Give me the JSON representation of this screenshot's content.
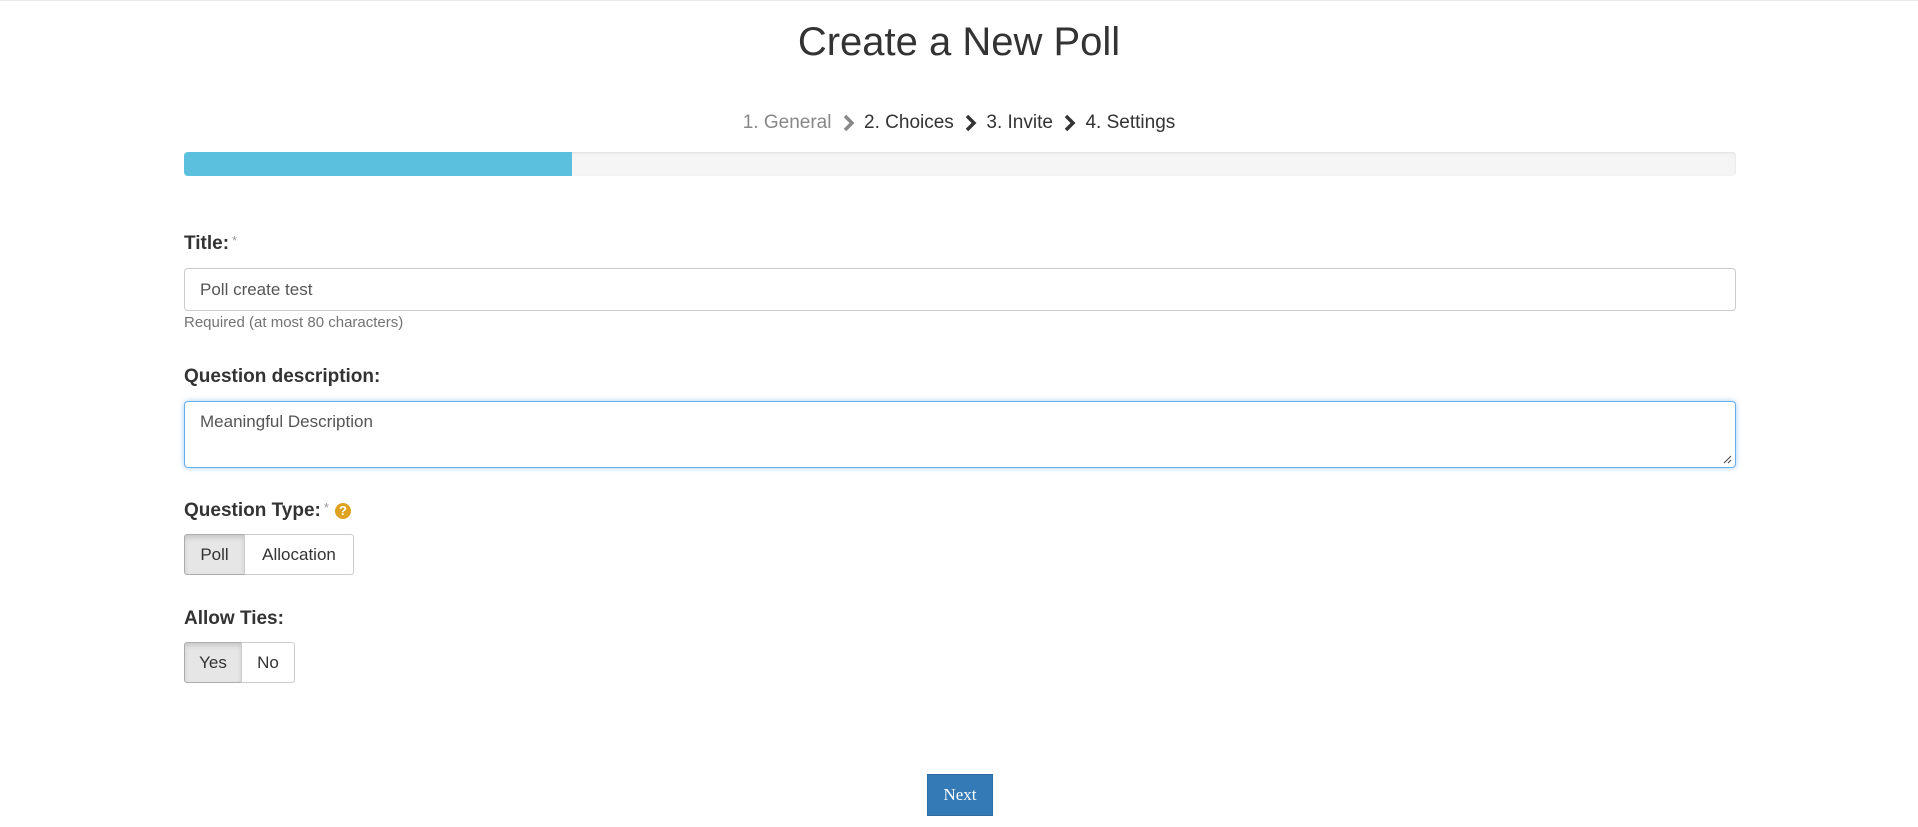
{
  "page": {
    "title": "Create a New Poll"
  },
  "steps": [
    {
      "label": "1. General",
      "state": "completed"
    },
    {
      "label": "2. Choices",
      "state": "pending"
    },
    {
      "label": "3. Invite",
      "state": "pending"
    },
    {
      "label": "4. Settings",
      "state": "pending"
    }
  ],
  "progress": {
    "fraction": 0.25,
    "color": "#5bc0de"
  },
  "form": {
    "title": {
      "label": "Title:",
      "required_mark": "*",
      "value": "Poll create test",
      "help": "Required (at most 80 characters)"
    },
    "description": {
      "label": "Question description:",
      "value": "Meaningful Description"
    },
    "question_type": {
      "label": "Question Type:",
      "required_mark": "*",
      "help_icon": "question-circle-icon",
      "options": [
        "Poll",
        "Allocation"
      ],
      "selected": "Poll"
    },
    "allow_ties": {
      "label": "Allow Ties:",
      "options": [
        "Yes",
        "No"
      ],
      "selected": "Yes"
    }
  },
  "actions": {
    "next_label": "Next",
    "next_color": "#337ab7"
  },
  "colors": {
    "accent": "#5bc0de",
    "help_icon": "#e0a21e",
    "focus_border": "#66afe9"
  }
}
